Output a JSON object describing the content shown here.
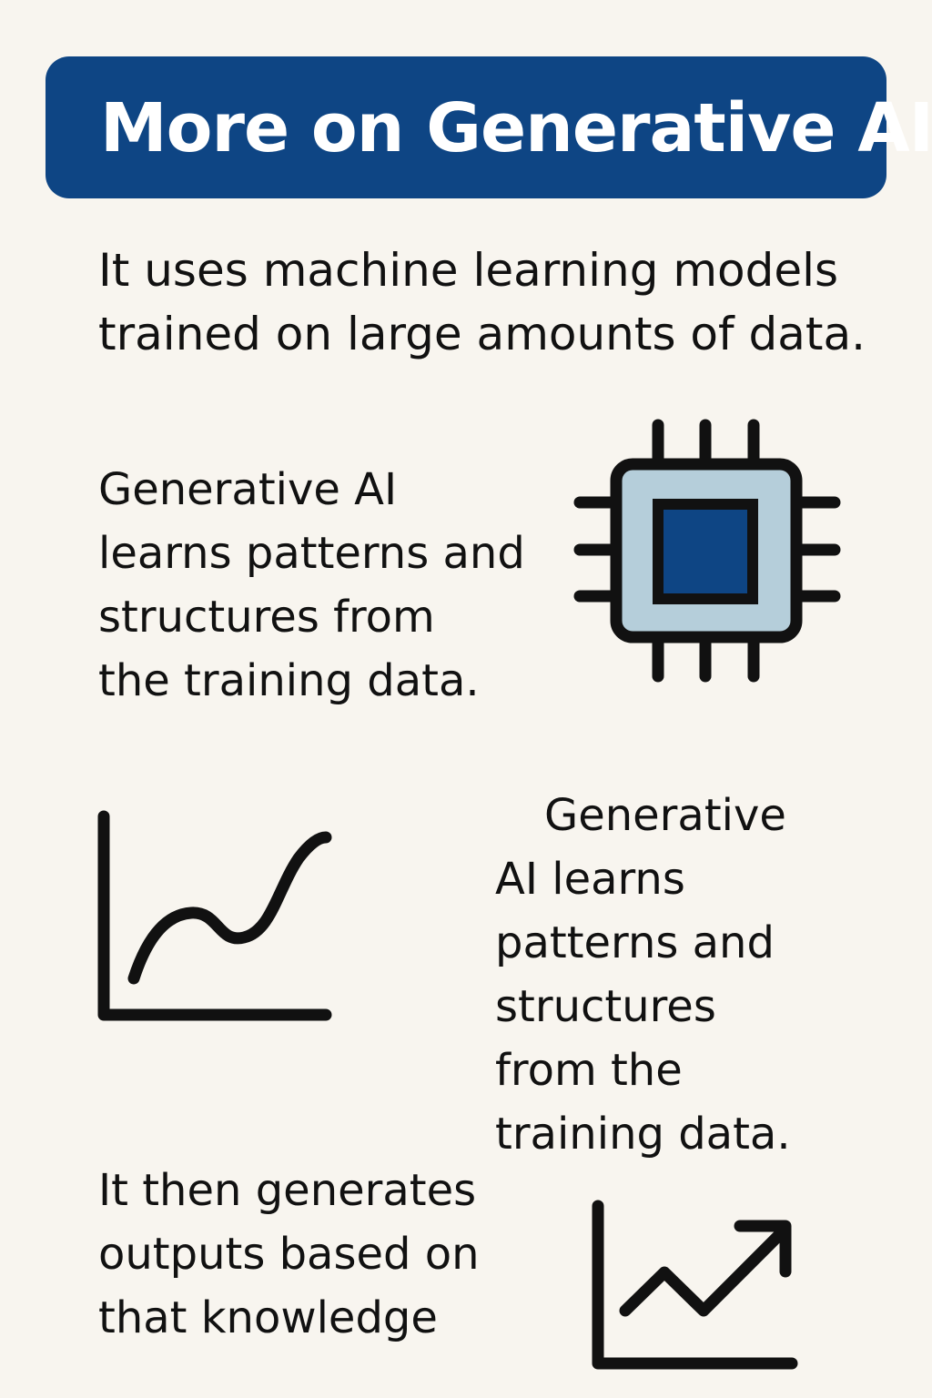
{
  "title": "More on Generative AI",
  "intro": {
    "lines": [
      "It uses machine learning models",
      "trained on large amounts of data."
    ]
  },
  "section_learns": {
    "lines": [
      "Generative AI",
      "learns patterns and",
      "structures from",
      "the training data."
    ],
    "icon": "microchip-icon"
  },
  "section_learns_repeat": {
    "lines": [
      "Generative",
      "AI learns",
      "patterns and",
      "structures",
      "from the",
      "training data."
    ],
    "icon": "line-graph-icon"
  },
  "section_generates": {
    "lines": [
      "It then generates",
      "outputs based on",
      "that knowledge"
    ],
    "icon": "trending-up-chart-icon"
  },
  "colors": {
    "accent": "#0e4584",
    "chip_body": "#b5ceda",
    "background": "#f8f5ef",
    "ink": "#111111"
  }
}
